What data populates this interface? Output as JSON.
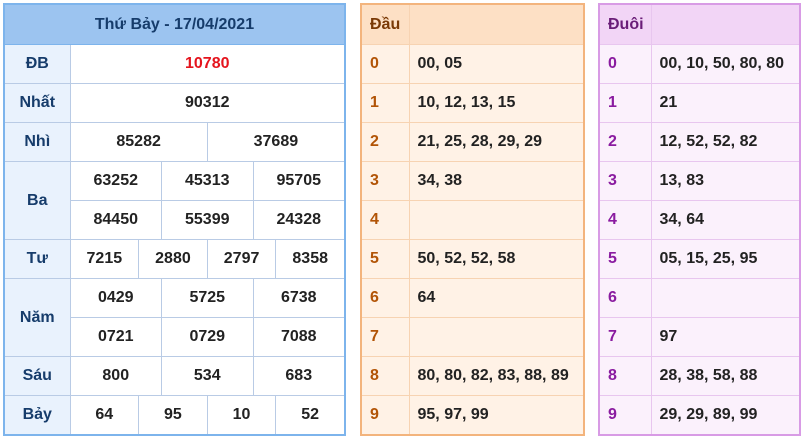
{
  "results": {
    "title": "Thứ Bảy - 17/04/2021",
    "prizes": [
      {
        "label": "ĐB",
        "rows": [
          [
            "10780"
          ]
        ],
        "special": true
      },
      {
        "label": "Nhất",
        "rows": [
          [
            "90312"
          ]
        ]
      },
      {
        "label": "Nhì",
        "rows": [
          [
            "85282",
            "37689"
          ]
        ]
      },
      {
        "label": "Ba",
        "rows": [
          [
            "63252",
            "45313",
            "95705"
          ],
          [
            "84450",
            "55399",
            "24328"
          ]
        ]
      },
      {
        "label": "Tư",
        "rows": [
          [
            "7215",
            "2880",
            "2797",
            "8358"
          ]
        ]
      },
      {
        "label": "Năm",
        "rows": [
          [
            "0429",
            "5725",
            "6738"
          ],
          [
            "0721",
            "0729",
            "7088"
          ]
        ]
      },
      {
        "label": "Sáu",
        "rows": [
          [
            "800",
            "534",
            "683"
          ]
        ]
      },
      {
        "label": "Bảy",
        "rows": [
          [
            "64",
            "95",
            "10",
            "52"
          ]
        ]
      }
    ]
  },
  "dau": {
    "header": "Đầu",
    "rows": [
      {
        "k": "0",
        "v": "00, 05"
      },
      {
        "k": "1",
        "v": "10, 12, 13, 15"
      },
      {
        "k": "2",
        "v": "21, 25, 28, 29, 29"
      },
      {
        "k": "3",
        "v": "34, 38"
      },
      {
        "k": "4",
        "v": ""
      },
      {
        "k": "5",
        "v": "50, 52, 52, 58"
      },
      {
        "k": "6",
        "v": "64"
      },
      {
        "k": "7",
        "v": ""
      },
      {
        "k": "8",
        "v": "80, 80, 82, 83, 88, 89"
      },
      {
        "k": "9",
        "v": "95, 97, 99"
      }
    ]
  },
  "duoi": {
    "header": "Đuôi",
    "rows": [
      {
        "k": "0",
        "v": "00, 10, 50, 80, 80"
      },
      {
        "k": "1",
        "v": "21"
      },
      {
        "k": "2",
        "v": "12, 52, 52, 82"
      },
      {
        "k": "3",
        "v": "13, 83"
      },
      {
        "k": "4",
        "v": "34, 64"
      },
      {
        "k": "5",
        "v": "05, 15, 25, 95"
      },
      {
        "k": "6",
        "v": ""
      },
      {
        "k": "7",
        "v": "97"
      },
      {
        "k": "8",
        "v": "28, 38, 58, 88"
      },
      {
        "k": "9",
        "v": "29, 29, 89, 99"
      }
    ]
  },
  "colors": {
    "special": "#e5141d",
    "results_header": "#9cc4f0",
    "dau_accent": "#f3b47d",
    "duoi_accent": "#d89be5"
  }
}
